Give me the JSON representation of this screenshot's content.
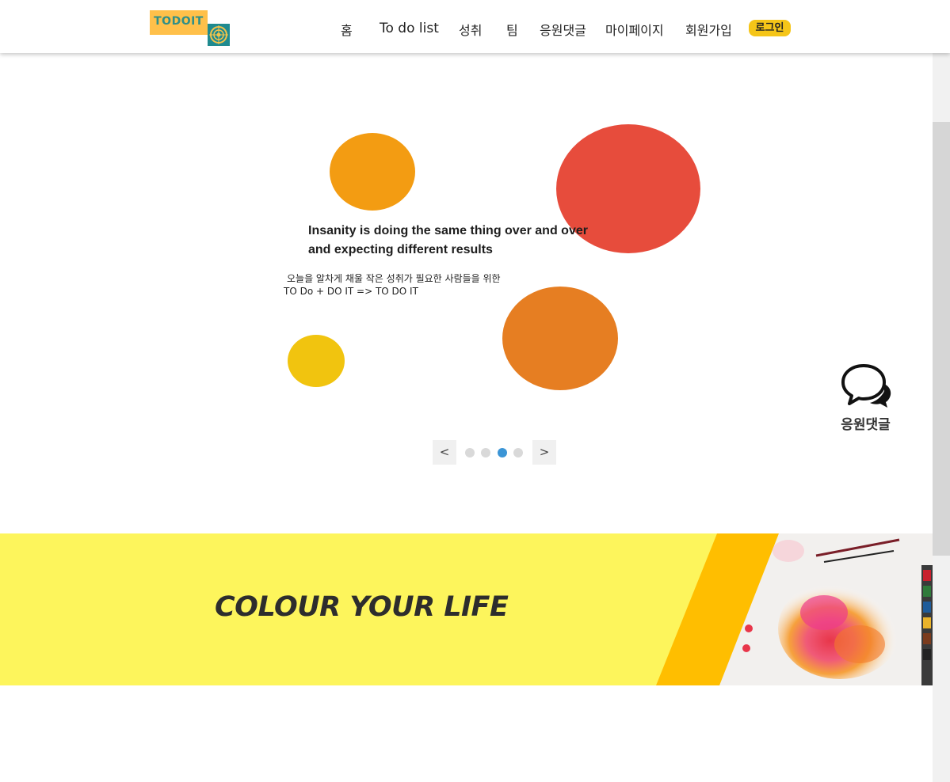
{
  "header": {
    "logo_text": "TODOIT",
    "nav": [
      {
        "label": "홈"
      },
      {
        "label": "To do list"
      },
      {
        "label": "성취"
      },
      {
        "label": "팀"
      },
      {
        "label": "응원댓글"
      },
      {
        "label": "마이페이지"
      },
      {
        "label": "회원가입"
      }
    ],
    "login_label": "로그인"
  },
  "hero": {
    "quote": "Insanity is doing the same thing over and over and expecting different results",
    "subtitle_line1": "오늘을 알차게 채울 작은 성취가 필요한 사람들을 위한",
    "subtitle_line2": "TO Do + DO IT => TO DO IT",
    "circles": [
      {
        "color": "#f39c12"
      },
      {
        "color": "#e74c3c"
      },
      {
        "color": "#e67e22"
      },
      {
        "color": "#f1c40f"
      }
    ]
  },
  "slider": {
    "prev_label": "<",
    "next_label": ">",
    "dot_count": 4,
    "active_dot": 3
  },
  "cheer_widget": {
    "icon": "chat-bubbles-icon",
    "label": "응원댓글"
  },
  "banner": {
    "title": "COLOUR YOUR LIFE",
    "colors": {
      "base": "#fdf55c",
      "stripe": "#ffbe00"
    }
  }
}
